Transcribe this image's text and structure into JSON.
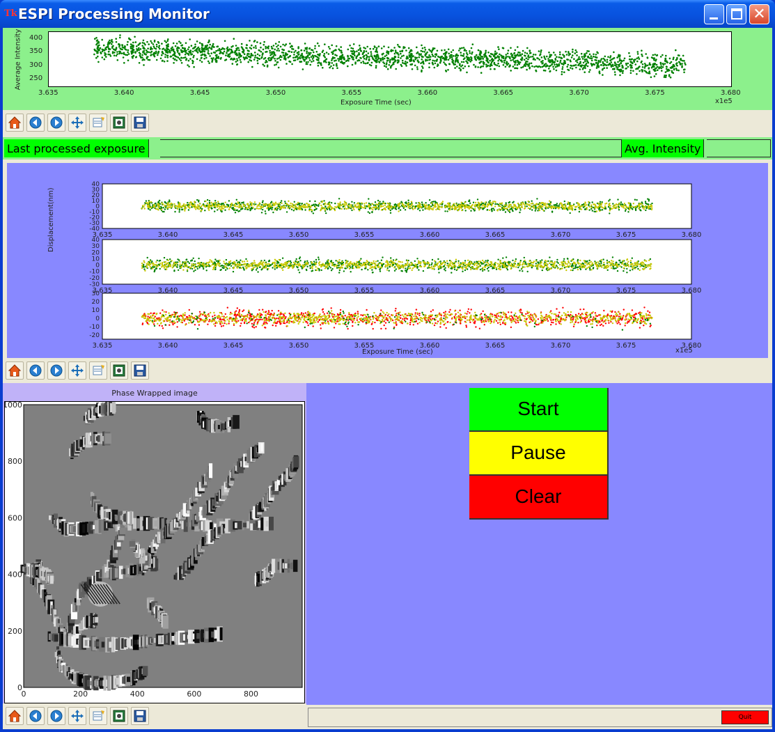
{
  "window": {
    "title": "ESPI Processing Monitor",
    "logo_text": "Tk"
  },
  "intensity_plot": {
    "toolbar": [
      "home-icon",
      "back-icon",
      "forward-icon",
      "pan-icon",
      "subplots-icon",
      "zoom-rect-icon",
      "save-icon"
    ]
  },
  "status": {
    "last_exposure_label": "Last processed exposure",
    "last_exposure_value": "",
    "avg_intensity_label": "Avg. Intensity",
    "avg_intensity_value": ""
  },
  "displacement_plot": {
    "toolbar": [
      "home-icon",
      "back-icon",
      "forward-icon",
      "pan-icon",
      "subplots-icon",
      "zoom-rect-icon",
      "save-icon"
    ]
  },
  "phase_image": {
    "title": "Phase Wrapped image",
    "toolbar": [
      "home-icon",
      "back-icon",
      "forward-icon",
      "pan-icon",
      "subplots-icon",
      "zoom-rect-icon",
      "save-icon"
    ]
  },
  "controls": {
    "start_label": "Start",
    "pause_label": "Pause",
    "clear_label": "Clear",
    "quit_label": "Quit",
    "status_text": ""
  },
  "colors": {
    "start": "#00ff00",
    "pause": "#ffff00",
    "clear": "#ff0000",
    "green_panel": "#8cf08c",
    "blue_panel": "#8888ff"
  },
  "chart_data": [
    {
      "type": "scatter",
      "title": "",
      "xlabel": "Exposure Time (sec)",
      "ylabel": "Average Intensity",
      "x_tick_labels": [
        "3.635",
        "3.640",
        "3.645",
        "3.650",
        "3.655",
        "3.660",
        "3.665",
        "3.670",
        "3.675",
        "3.680"
      ],
      "y_tick_labels": [
        "250",
        "300",
        "350",
        "400"
      ],
      "x_offset_label": "x1e5",
      "xlim": [
        363500,
        368000
      ],
      "ylim": [
        225,
        425
      ],
      "series": [
        {
          "color": "#008000",
          "x": [
            363800,
            364000,
            364200,
            364500,
            365000,
            365500,
            366000,
            366500,
            367000,
            367500,
            367700
          ],
          "y": [
            365,
            360,
            355,
            350,
            345,
            335,
            330,
            325,
            315,
            305,
            305
          ]
        }
      ]
    },
    {
      "type": "scatter",
      "title": "",
      "xlabel": "Exposure Time (sec)",
      "ylabel": "Displacement(nm)",
      "x_offset_label": "x1e5",
      "x_tick_labels": [
        "3.635",
        "3.640",
        "3.645",
        "3.650",
        "3.655",
        "3.660",
        "3.665",
        "3.670",
        "3.675",
        "3.680"
      ],
      "xlim": [
        363500,
        368000
      ],
      "panels": [
        {
          "y_tick_labels": [
            "40",
            "30",
            "20",
            "10",
            "0",
            "-10",
            "-20",
            "-30",
            "-40"
          ],
          "ylim": [
            -40,
            40
          ],
          "series": [
            {
              "color": "#008000",
              "x": [
                363800,
                367700
              ],
              "y": [
                0,
                0
              ]
            },
            {
              "color": "#c8c800",
              "x": [
                363800,
                367700
              ],
              "y": [
                0,
                0
              ]
            }
          ]
        },
        {
          "y_tick_labels": [
            "40",
            "30",
            "20",
            "10",
            "0",
            "-10",
            "-20",
            "-30"
          ],
          "ylim": [
            -30,
            40
          ],
          "series": [
            {
              "color": "#008000",
              "x": [
                363800,
                367700
              ],
              "y": [
                0,
                0
              ]
            },
            {
              "color": "#c8c800",
              "x": [
                363800,
                367700
              ],
              "y": [
                0,
                0
              ]
            }
          ]
        },
        {
          "y_tick_labels": [
            "30",
            "20",
            "10",
            "0",
            "-10",
            "-20"
          ],
          "ylim": [
            -25,
            30
          ],
          "series": [
            {
              "color": "#ff0000",
              "x": [
                363800,
                367700
              ],
              "y": [
                0,
                0
              ]
            },
            {
              "color": "#c8c800",
              "x": [
                363800,
                367700
              ],
              "y": [
                0,
                0
              ]
            },
            {
              "color": "#008000",
              "x": [
                363800,
                367700
              ],
              "y": [
                0,
                0
              ]
            }
          ]
        }
      ]
    },
    {
      "type": "heatmap",
      "title": "Phase Wrapped image",
      "x_tick_labels": [
        "0",
        "200",
        "400",
        "600",
        "800"
      ],
      "y_tick_labels": [
        "1000",
        "800",
        "600",
        "400",
        "200",
        "0"
      ],
      "xlim": [
        0,
        980
      ],
      "ylim": [
        0,
        1000
      ]
    }
  ]
}
